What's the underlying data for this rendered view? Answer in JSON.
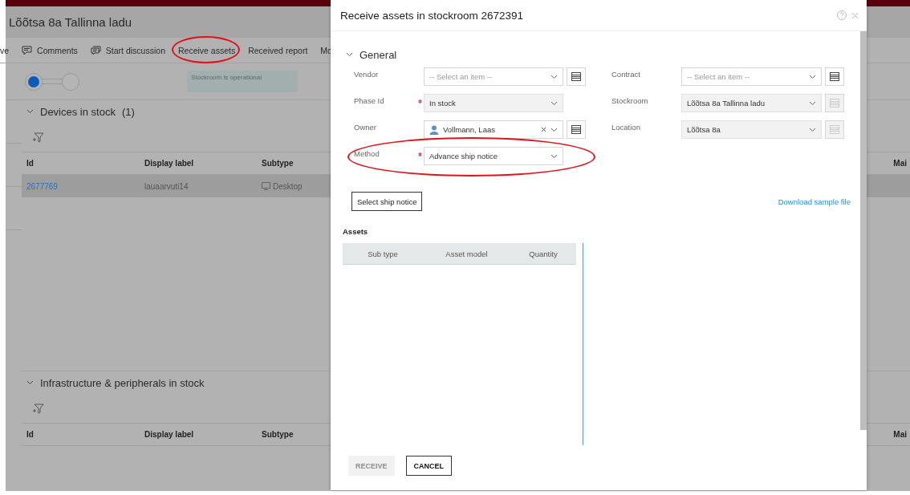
{
  "page": {
    "title": "Lõõtsa 8a Tallinna ladu",
    "toolbar": [
      {
        "label": "ve",
        "kind": "plain",
        "circled": false
      },
      {
        "label": "Comments",
        "kind": "comment",
        "circled": false
      },
      {
        "label": "Start discussion",
        "kind": "discussion",
        "circled": false
      },
      {
        "label": "Receive assets",
        "kind": "plain",
        "circled": true
      },
      {
        "label": "Received report",
        "kind": "plain",
        "circled": false
      },
      {
        "label": "Mo",
        "kind": "plain",
        "circled": false
      }
    ],
    "stepper": [
      {
        "selected": true
      },
      {
        "selected": false
      }
    ],
    "status_tooltip": "Stockroom is operational",
    "sections": [
      {
        "title": "Devices in stock",
        "count": "(1)",
        "columns": [
          "Id",
          "Display label",
          "Subtype"
        ],
        "last_column": "Mai",
        "rows": [
          {
            "selected": true,
            "cells": [
              {
                "text": "2677769",
                "kind": "link"
              },
              {
                "text": "lauaarvuti14",
                "kind": "text"
              },
              {
                "text": "Desktop",
                "kind": "device"
              }
            ]
          }
        ]
      },
      {
        "title": "Infrastructure & peripherals in stock",
        "columns": [
          "Id",
          "Display label",
          "Subtype"
        ],
        "last_column": "Mai"
      }
    ]
  },
  "dialog": {
    "title": "Receive assets in stockroom 2672391",
    "section": {
      "title": "General",
      "expanded": true
    },
    "fields_left": [
      {
        "label": "Vendor",
        "required": false,
        "placeholder": "-- Select an item --",
        "disabled": false,
        "lookup": true
      },
      {
        "label": "Phase Id",
        "required": true,
        "value": "In stock",
        "disabled": true,
        "lookup": false
      },
      {
        "label": "Owner",
        "required": false,
        "value": "Vollmann, Laas",
        "kind": "person",
        "clearable": true,
        "disabled": false,
        "lookup": true
      },
      {
        "label": "Method",
        "required": true,
        "value": "Advance ship notice",
        "disabled": false,
        "lookup": false,
        "circled": true
      }
    ],
    "fields_right": [
      {
        "label": "Contract",
        "required": false,
        "placeholder": "-- Select an item --",
        "disabled": false,
        "lookup": true
      },
      {
        "label": "Stockroom",
        "required": false,
        "value": "Lõõtsa 8a Tallinna ladu",
        "disabled": true,
        "lookup": true
      },
      {
        "label": "Location",
        "required": false,
        "value": "Lõõtsa 8a",
        "disabled": true,
        "lookup": true
      }
    ],
    "select_button": "Select ship notice",
    "download_link": "Download sample file",
    "assets": {
      "title": "Assets",
      "columns": [
        "Sub type",
        "Asset model",
        "Quantity"
      ]
    },
    "actions": [
      {
        "label": "RECEIVE",
        "disabled": true
      },
      {
        "label": "CANCEL",
        "disabled": false
      }
    ]
  }
}
